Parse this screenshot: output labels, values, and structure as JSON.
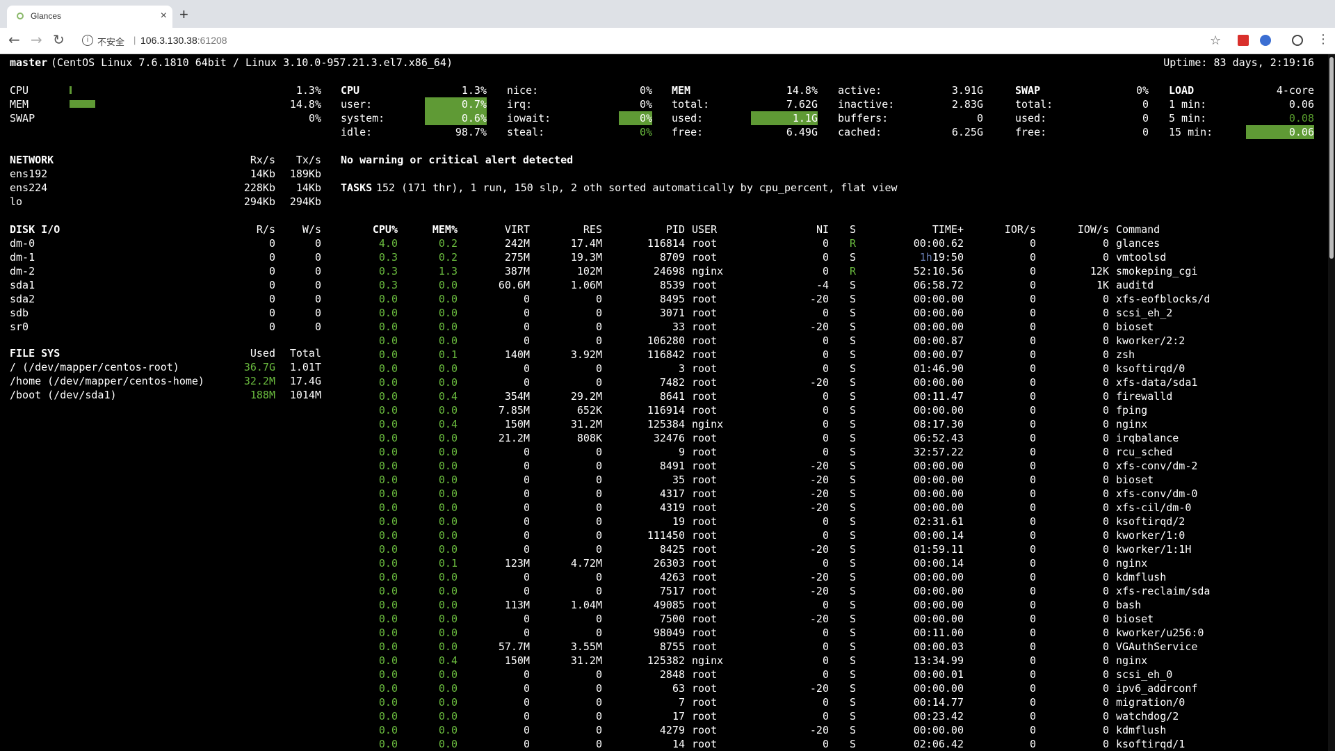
{
  "browser": {
    "tab_title": "Glances",
    "tab_close": "×",
    "new_tab": "+",
    "insecure_label": "不安全",
    "url_host": "106.3.130.38",
    "url_port": ":61208",
    "icons": [
      "back-icon",
      "forward-icon",
      "reload-icon",
      "info-icon",
      "star-icon",
      "extension-icons",
      "menu-icon"
    ]
  },
  "header": {
    "hostname": "master",
    "os": "(CentOS Linux 7.6.1810 64bit / Linux 3.10.0-957.21.3.el7.x86_64)",
    "uptime": "Uptime: 83 days, 2:19:16"
  },
  "quicklook": [
    {
      "label": "CPU",
      "value": "1.3%",
      "fraction": 0.013
    },
    {
      "label": "MEM",
      "value": "14.8%",
      "fraction": 0.148
    },
    {
      "label": "SWAP",
      "value": "0%",
      "fraction": 0
    }
  ],
  "cpu": {
    "title": "CPU",
    "total": "1.3%",
    "user_label": "user:",
    "user": "0.7%",
    "system_label": "system:",
    "system": "0.6%",
    "idle_label": "idle:",
    "idle": "98.7%",
    "nice_label": "nice:",
    "nice": "0%",
    "irq_label": "irq:",
    "irq": "0%",
    "iowait_label": "iowait:",
    "iowait": "0%",
    "steal_label": "steal:",
    "steal": "0%"
  },
  "mem": {
    "title": "MEM",
    "percent": "14.8%",
    "total_label": "total:",
    "total": "7.62G",
    "used_label": "used:",
    "used": "1.1G",
    "free_label": "free:",
    "free": "6.49G",
    "active_label": "active:",
    "active": "3.91G",
    "inactive_label": "inactive:",
    "inactive": "2.83G",
    "buffers_label": "buffers:",
    "buffers": "0",
    "cached_label": "cached:",
    "cached": "6.25G"
  },
  "swap": {
    "title": "SWAP",
    "percent": "0%",
    "total_label": "total:",
    "total": "0",
    "used_label": "used:",
    "used": "0",
    "free_label": "free:",
    "free": "0"
  },
  "load": {
    "title": "LOAD",
    "cores": "4-core",
    "m1_label": "1 min:",
    "m1": "0.06",
    "m5_label": "5 min:",
    "m5": "0.08",
    "m15_label": "15 min:",
    "m15": "0.06"
  },
  "network": {
    "title": "NETWORK",
    "rx_header": "Rx/s",
    "tx_header": "Tx/s",
    "rows": [
      {
        "name": "ens192",
        "rx": "14Kb",
        "tx": "189Kb"
      },
      {
        "name": "ens224",
        "rx": "228Kb",
        "tx": "14Kb"
      },
      {
        "name": "lo",
        "rx": "294Kb",
        "tx": "294Kb"
      }
    ]
  },
  "diskio": {
    "title": "DISK I/O",
    "r_header": "R/s",
    "w_header": "W/s",
    "rows": [
      {
        "name": "dm-0",
        "r": "0",
        "w": "0"
      },
      {
        "name": "dm-1",
        "r": "0",
        "w": "0"
      },
      {
        "name": "dm-2",
        "r": "0",
        "w": "0"
      },
      {
        "name": "sda1",
        "r": "0",
        "w": "0"
      },
      {
        "name": "sda2",
        "r": "0",
        "w": "0"
      },
      {
        "name": "sdb",
        "r": "0",
        "w": "0"
      },
      {
        "name": "sr0",
        "r": "0",
        "w": "0"
      }
    ]
  },
  "filesys": {
    "title": "FILE SYS",
    "used_header": "Used",
    "total_header": "Total",
    "rows": [
      {
        "name": "/ (/dev/mapper/centos-root)",
        "used": "36.7G",
        "total": "1.01T"
      },
      {
        "name": "/home (/dev/mapper/centos-home)",
        "used": "32.2M",
        "total": "17.4G"
      },
      {
        "name": "/boot (/dev/sda1)",
        "used": "188M",
        "total": "1014M"
      }
    ]
  },
  "alert": "No warning or critical alert detected",
  "tasks": {
    "label": "TASKS",
    "summary": "152 (171 thr), 1 run, 150 slp, 2 oth sorted automatically by cpu_percent, flat view"
  },
  "process_headers": {
    "cpu": "CPU%",
    "mem": "MEM%",
    "virt": "VIRT",
    "res": "RES",
    "pid": "PID",
    "user": "USER",
    "ni": "NI",
    "s": "S",
    "time": "TIME+",
    "ior": "IOR/s",
    "iow": "IOW/s",
    "cmd": "Command"
  },
  "processes": [
    {
      "cpu": "4.0",
      "mem": "0.2",
      "virt": "242M",
      "res": "17.4M",
      "pid": "116814",
      "user": "root",
      "ni": "0",
      "s": "R",
      "time": "00:00.62",
      "ior": "0",
      "iow": "0",
      "cmd": "glances"
    },
    {
      "cpu": "0.3",
      "mem": "0.2",
      "virt": "275M",
      "res": "19.3M",
      "pid": "8709",
      "user": "root",
      "ni": "0",
      "s": "S",
      "time_h": "1h",
      "time": "19:50",
      "ior": "0",
      "iow": "0",
      "cmd": "vmtoolsd"
    },
    {
      "cpu": "0.3",
      "mem": "1.3",
      "virt": "387M",
      "res": "102M",
      "pid": "24698",
      "user": "nginx",
      "ni": "0",
      "s": "R",
      "time": "52:10.56",
      "ior": "0",
      "iow": "12K",
      "cmd": "smokeping_cgi"
    },
    {
      "cpu": "0.3",
      "mem": "0.0",
      "virt": "60.6M",
      "res": "1.06M",
      "pid": "8539",
      "user": "root",
      "ni": "-4",
      "s": "S",
      "time": "06:58.72",
      "ior": "0",
      "iow": "1K",
      "cmd": "auditd"
    },
    {
      "cpu": "0.0",
      "mem": "0.0",
      "virt": "0",
      "res": "0",
      "pid": "8495",
      "user": "root",
      "ni": "-20",
      "s": "S",
      "time": "00:00.00",
      "ior": "0",
      "iow": "0",
      "cmd": "xfs-eofblocks/d"
    },
    {
      "cpu": "0.0",
      "mem": "0.0",
      "virt": "0",
      "res": "0",
      "pid": "3071",
      "user": "root",
      "ni": "0",
      "s": "S",
      "time": "00:00.00",
      "ior": "0",
      "iow": "0",
      "cmd": "scsi_eh_2"
    },
    {
      "cpu": "0.0",
      "mem": "0.0",
      "virt": "0",
      "res": "0",
      "pid": "33",
      "user": "root",
      "ni": "-20",
      "s": "S",
      "time": "00:00.00",
      "ior": "0",
      "iow": "0",
      "cmd": "bioset"
    },
    {
      "cpu": "0.0",
      "mem": "0.0",
      "virt": "0",
      "res": "0",
      "pid": "106280",
      "user": "root",
      "ni": "0",
      "s": "S",
      "time": "00:00.87",
      "ior": "0",
      "iow": "0",
      "cmd": "kworker/2:2"
    },
    {
      "cpu": "0.0",
      "mem": "0.1",
      "virt": "140M",
      "res": "3.92M",
      "pid": "116842",
      "user": "root",
      "ni": "0",
      "s": "S",
      "time": "00:00.07",
      "ior": "0",
      "iow": "0",
      "cmd": "zsh"
    },
    {
      "cpu": "0.0",
      "mem": "0.0",
      "virt": "0",
      "res": "0",
      "pid": "3",
      "user": "root",
      "ni": "0",
      "s": "S",
      "time": "01:46.90",
      "ior": "0",
      "iow": "0",
      "cmd": "ksoftirqd/0"
    },
    {
      "cpu": "0.0",
      "mem": "0.0",
      "virt": "0",
      "res": "0",
      "pid": "7482",
      "user": "root",
      "ni": "-20",
      "s": "S",
      "time": "00:00.00",
      "ior": "0",
      "iow": "0",
      "cmd": "xfs-data/sda1"
    },
    {
      "cpu": "0.0",
      "mem": "0.4",
      "virt": "354M",
      "res": "29.2M",
      "pid": "8641",
      "user": "root",
      "ni": "0",
      "s": "S",
      "time": "00:11.47",
      "ior": "0",
      "iow": "0",
      "cmd": "firewalld"
    },
    {
      "cpu": "0.0",
      "mem": "0.0",
      "virt": "7.85M",
      "res": "652K",
      "pid": "116914",
      "user": "root",
      "ni": "0",
      "s": "S",
      "time": "00:00.00",
      "ior": "0",
      "iow": "0",
      "cmd": "fping"
    },
    {
      "cpu": "0.0",
      "mem": "0.4",
      "virt": "150M",
      "res": "31.2M",
      "pid": "125384",
      "user": "nginx",
      "ni": "0",
      "s": "S",
      "time": "08:17.30",
      "ior": "0",
      "iow": "0",
      "cmd": "nginx"
    },
    {
      "cpu": "0.0",
      "mem": "0.0",
      "virt": "21.2M",
      "res": "808K",
      "pid": "32476",
      "user": "root",
      "ni": "0",
      "s": "S",
      "time": "06:52.43",
      "ior": "0",
      "iow": "0",
      "cmd": "irqbalance"
    },
    {
      "cpu": "0.0",
      "mem": "0.0",
      "virt": "0",
      "res": "0",
      "pid": "9",
      "user": "root",
      "ni": "0",
      "s": "S",
      "time": "32:57.22",
      "ior": "0",
      "iow": "0",
      "cmd": "rcu_sched"
    },
    {
      "cpu": "0.0",
      "mem": "0.0",
      "virt": "0",
      "res": "0",
      "pid": "8491",
      "user": "root",
      "ni": "-20",
      "s": "S",
      "time": "00:00.00",
      "ior": "0",
      "iow": "0",
      "cmd": "xfs-conv/dm-2"
    },
    {
      "cpu": "0.0",
      "mem": "0.0",
      "virt": "0",
      "res": "0",
      "pid": "35",
      "user": "root",
      "ni": "-20",
      "s": "S",
      "time": "00:00.00",
      "ior": "0",
      "iow": "0",
      "cmd": "bioset"
    },
    {
      "cpu": "0.0",
      "mem": "0.0",
      "virt": "0",
      "res": "0",
      "pid": "4317",
      "user": "root",
      "ni": "-20",
      "s": "S",
      "time": "00:00.00",
      "ior": "0",
      "iow": "0",
      "cmd": "xfs-conv/dm-0"
    },
    {
      "cpu": "0.0",
      "mem": "0.0",
      "virt": "0",
      "res": "0",
      "pid": "4319",
      "user": "root",
      "ni": "-20",
      "s": "S",
      "time": "00:00.00",
      "ior": "0",
      "iow": "0",
      "cmd": "xfs-cil/dm-0"
    },
    {
      "cpu": "0.0",
      "mem": "0.0",
      "virt": "0",
      "res": "0",
      "pid": "19",
      "user": "root",
      "ni": "0",
      "s": "S",
      "time": "02:31.61",
      "ior": "0",
      "iow": "0",
      "cmd": "ksoftirqd/2"
    },
    {
      "cpu": "0.0",
      "mem": "0.0",
      "virt": "0",
      "res": "0",
      "pid": "111450",
      "user": "root",
      "ni": "0",
      "s": "S",
      "time": "00:00.14",
      "ior": "0",
      "iow": "0",
      "cmd": "kworker/1:0"
    },
    {
      "cpu": "0.0",
      "mem": "0.0",
      "virt": "0",
      "res": "0",
      "pid": "8425",
      "user": "root",
      "ni": "-20",
      "s": "S",
      "time": "01:59.11",
      "ior": "0",
      "iow": "0",
      "cmd": "kworker/1:1H"
    },
    {
      "cpu": "0.0",
      "mem": "0.1",
      "virt": "123M",
      "res": "4.72M",
      "pid": "26303",
      "user": "root",
      "ni": "0",
      "s": "S",
      "time": "00:00.14",
      "ior": "0",
      "iow": "0",
      "cmd": "nginx"
    },
    {
      "cpu": "0.0",
      "mem": "0.0",
      "virt": "0",
      "res": "0",
      "pid": "4263",
      "user": "root",
      "ni": "-20",
      "s": "S",
      "time": "00:00.00",
      "ior": "0",
      "iow": "0",
      "cmd": "kdmflush"
    },
    {
      "cpu": "0.0",
      "mem": "0.0",
      "virt": "0",
      "res": "0",
      "pid": "7517",
      "user": "root",
      "ni": "-20",
      "s": "S",
      "time": "00:00.00",
      "ior": "0",
      "iow": "0",
      "cmd": "xfs-reclaim/sda"
    },
    {
      "cpu": "0.0",
      "mem": "0.0",
      "virt": "113M",
      "res": "1.04M",
      "pid": "49085",
      "user": "root",
      "ni": "0",
      "s": "S",
      "time": "00:00.00",
      "ior": "0",
      "iow": "0",
      "cmd": "bash"
    },
    {
      "cpu": "0.0",
      "mem": "0.0",
      "virt": "0",
      "res": "0",
      "pid": "7500",
      "user": "root",
      "ni": "-20",
      "s": "S",
      "time": "00:00.00",
      "ior": "0",
      "iow": "0",
      "cmd": "bioset"
    },
    {
      "cpu": "0.0",
      "mem": "0.0",
      "virt": "0",
      "res": "0",
      "pid": "98049",
      "user": "root",
      "ni": "0",
      "s": "S",
      "time": "00:11.00",
      "ior": "0",
      "iow": "0",
      "cmd": "kworker/u256:0"
    },
    {
      "cpu": "0.0",
      "mem": "0.0",
      "virt": "57.7M",
      "res": "3.55M",
      "pid": "8755",
      "user": "root",
      "ni": "0",
      "s": "S",
      "time": "00:00.03",
      "ior": "0",
      "iow": "0",
      "cmd": "VGAuthService"
    },
    {
      "cpu": "0.0",
      "mem": "0.4",
      "virt": "150M",
      "res": "31.2M",
      "pid": "125382",
      "user": "nginx",
      "ni": "0",
      "s": "S",
      "time": "13:34.99",
      "ior": "0",
      "iow": "0",
      "cmd": "nginx"
    },
    {
      "cpu": "0.0",
      "mem": "0.0",
      "virt": "0",
      "res": "0",
      "pid": "2848",
      "user": "root",
      "ni": "0",
      "s": "S",
      "time": "00:00.01",
      "ior": "0",
      "iow": "0",
      "cmd": "scsi_eh_0"
    },
    {
      "cpu": "0.0",
      "mem": "0.0",
      "virt": "0",
      "res": "0",
      "pid": "63",
      "user": "root",
      "ni": "-20",
      "s": "S",
      "time": "00:00.00",
      "ior": "0",
      "iow": "0",
      "cmd": "ipv6_addrconf"
    },
    {
      "cpu": "0.0",
      "mem": "0.0",
      "virt": "0",
      "res": "0",
      "pid": "7",
      "user": "root",
      "ni": "0",
      "s": "S",
      "time": "00:14.77",
      "ior": "0",
      "iow": "0",
      "cmd": "migration/0"
    },
    {
      "cpu": "0.0",
      "mem": "0.0",
      "virt": "0",
      "res": "0",
      "pid": "17",
      "user": "root",
      "ni": "0",
      "s": "S",
      "time": "00:23.42",
      "ior": "0",
      "iow": "0",
      "cmd": "watchdog/2"
    },
    {
      "cpu": "0.0",
      "mem": "0.0",
      "virt": "0",
      "res": "0",
      "pid": "4279",
      "user": "root",
      "ni": "-20",
      "s": "S",
      "time": "00:00.00",
      "ior": "0",
      "iow": "0",
      "cmd": "kdmflush"
    },
    {
      "cpu": "0.0",
      "mem": "0.0",
      "virt": "0",
      "res": "0",
      "pid": "14",
      "user": "root",
      "ni": "0",
      "s": "S",
      "time": "02:06.42",
      "ior": "0",
      "iow": "0",
      "cmd": "ksoftirqd/1"
    }
  ],
  "colors": {
    "accent_green": "#6bbd3f",
    "bar_green": "#5f9a35",
    "background": "#000000",
    "text": "#ffffff"
  }
}
